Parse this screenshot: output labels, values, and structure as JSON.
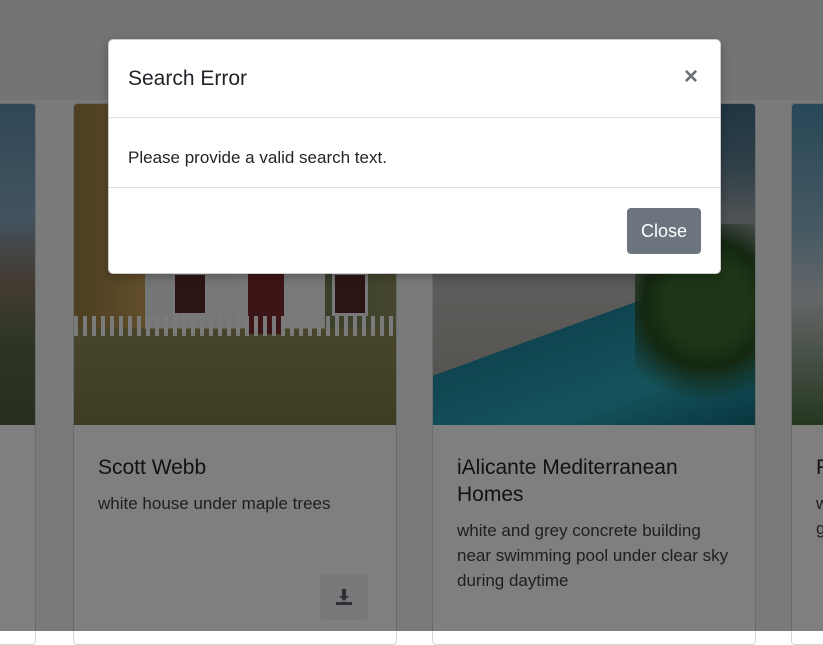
{
  "modal": {
    "title": "Search Error",
    "close_icon": "×",
    "message": "Please provide a valid search text.",
    "close_label": "Close"
  },
  "cards": [
    {
      "title": "",
      "description": ""
    },
    {
      "title": "Scott Webb",
      "description": "white house under maple trees"
    },
    {
      "title": "iAlicante Mediterranean Homes",
      "description": "white and grey concrete building near swimming pool under clear sky during daytime"
    },
    {
      "title": "F",
      "description": "w\ng"
    }
  ],
  "icons": {
    "download": "download-icon",
    "close": "close-icon"
  },
  "colors": {
    "backdrop": "rgba(0,0,0,0.5)",
    "close_button": "#6c757d"
  }
}
